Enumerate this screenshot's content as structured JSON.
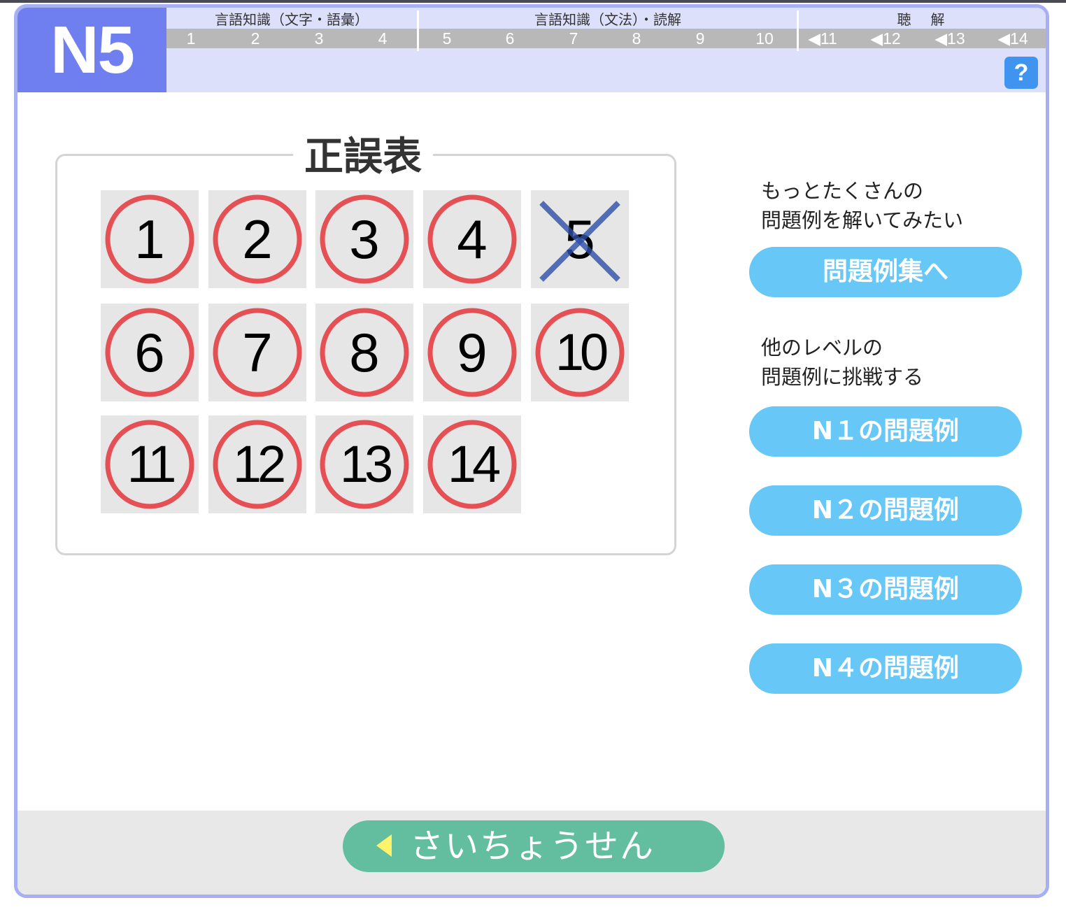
{
  "header": {
    "level": "N5",
    "sections": [
      {
        "title": "言語知識（文字・語彙）"
      },
      {
        "title": "言語知識（文法）・読解"
      },
      {
        "title": "聴　解"
      }
    ],
    "question_numbers": [
      "1",
      "2",
      "3",
      "4",
      "5",
      "6",
      "7",
      "8",
      "9",
      "10",
      "◀11",
      "◀12",
      "◀13",
      "◀14"
    ],
    "help_label": "?"
  },
  "scoreboard": {
    "title": "正誤表",
    "results": [
      {
        "num": "1",
        "mark": "correct"
      },
      {
        "num": "2",
        "mark": "correct"
      },
      {
        "num": "3",
        "mark": "correct"
      },
      {
        "num": "4",
        "mark": "correct"
      },
      {
        "num": "5",
        "mark": "wrong"
      },
      {
        "num": "6",
        "mark": "correct"
      },
      {
        "num": "7",
        "mark": "correct"
      },
      {
        "num": "8",
        "mark": "correct"
      },
      {
        "num": "9",
        "mark": "correct"
      },
      {
        "num": "10",
        "mark": "correct"
      },
      {
        "num": "11",
        "mark": "correct"
      },
      {
        "num": "12",
        "mark": "correct"
      },
      {
        "num": "13",
        "mark": "correct"
      },
      {
        "num": "14",
        "mark": "correct"
      }
    ],
    "colors": {
      "correct": "#e5484d",
      "wrong": "#2d4fa6"
    }
  },
  "sidebar": {
    "more_text_line1": "もっとたくさんの",
    "more_text_line2": "問題例を解いてみたい",
    "collection_button": "問題例集へ",
    "other_text_line1": "他のレベルの",
    "other_text_line2": "問題例に挑戦する",
    "level_buttons": [
      "N１の問題例",
      "N２の問題例",
      "N３の問題例",
      "N４の問題例"
    ]
  },
  "footer": {
    "retry_label": "さいちょうせん"
  }
}
